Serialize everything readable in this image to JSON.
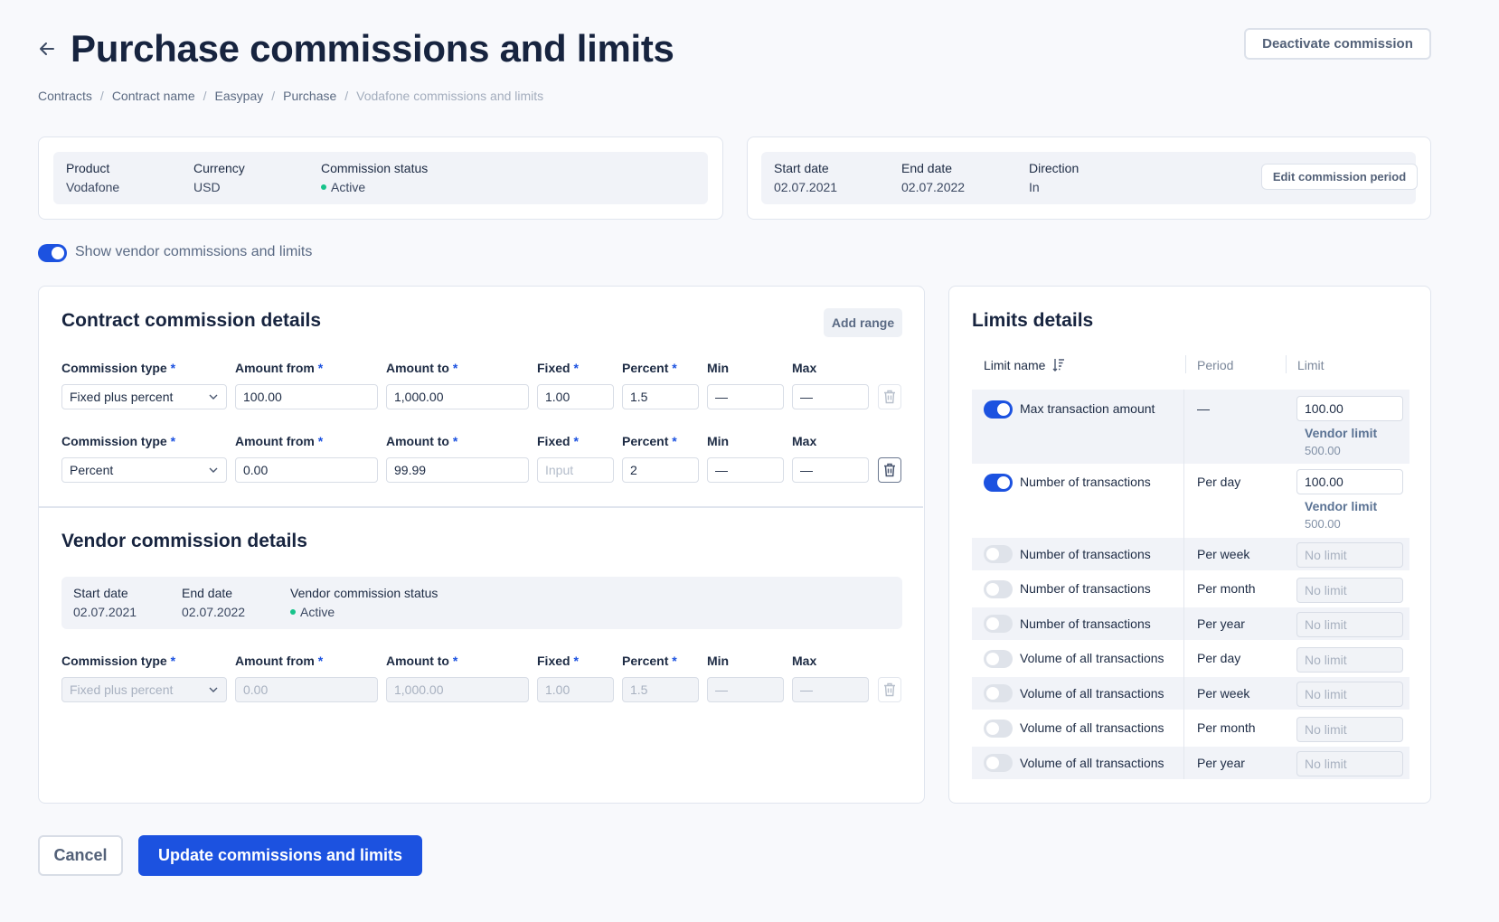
{
  "header": {
    "title": "Purchase commissions and limits",
    "deactivate_label": "Deactivate commission"
  },
  "breadcrumbs": [
    "Contracts",
    "Contract name",
    "Easypay",
    "Purchase",
    "Vodafone commissions and limits"
  ],
  "summary": {
    "product_label": "Product",
    "product": "Vodafone",
    "currency_label": "Currency",
    "currency": "USD",
    "status_label": "Commission status",
    "status": "Active",
    "start_label": "Start date",
    "start": "02.07.2021",
    "end_label": "End date",
    "end": "02.07.2022",
    "direction_label": "Direction",
    "direction": "In",
    "edit_period_label": "Edit commission period"
  },
  "show_vendor": {
    "label": "Show vendor commissions and limits",
    "on": true
  },
  "contract": {
    "title": "Contract commission details",
    "add_range": "Add range",
    "labels": {
      "type": "Commission type",
      "from": "Amount from",
      "to": "Amount to",
      "fixed": "Fixed",
      "percent": "Percent",
      "min": "Min",
      "max": "Max",
      "req": "*"
    },
    "rows": [
      {
        "type": "Fixed plus percent",
        "from": "100.00",
        "to": "1,000.00",
        "fixed": "1.00",
        "percent": "1.5",
        "min": "—",
        "max": "—"
      },
      {
        "type": "Percent",
        "from": "0.00",
        "to": "99.99",
        "fixed": "Input",
        "percent": "2",
        "min": "—",
        "max": "—"
      }
    ]
  },
  "vendor": {
    "title": "Vendor commission details",
    "start_label": "Start date",
    "start": "02.07.2021",
    "end_label": "End date",
    "end": "02.07.2022",
    "status_label": "Vendor commission status",
    "status": "Active",
    "row": {
      "type": "Fixed plus percent",
      "from": "0.00",
      "to": "1,000.00",
      "fixed": "1.00",
      "percent": "1.5",
      "min": "—",
      "max": "—"
    }
  },
  "limits": {
    "title": "Limits details",
    "headers": {
      "name": "Limit name",
      "period": "Period",
      "limit": "Limit"
    },
    "vendor_limit_label": "Vendor limit",
    "rows": [
      {
        "name": "Max transaction amount",
        "period": "—",
        "value": "100.00",
        "on": true,
        "vendor_limit": "500.00"
      },
      {
        "name": "Number of transactions",
        "period": "Per day",
        "value": "100.00",
        "on": true,
        "vendor_limit": "500.00"
      },
      {
        "name": "Number of transactions",
        "period": "Per week",
        "placeholder": "No limit",
        "on": false
      },
      {
        "name": "Number of transactions",
        "period": "Per month",
        "placeholder": "No limit",
        "on": false
      },
      {
        "name": "Number of transactions",
        "period": "Per year",
        "placeholder": "No limit",
        "on": false
      },
      {
        "name": "Volume of all transactions",
        "period": "Per day",
        "placeholder": "No limit",
        "on": false
      },
      {
        "name": "Volume of all transactions",
        "period": "Per week",
        "placeholder": "No limit",
        "on": false
      },
      {
        "name": "Volume of all transactions",
        "period": "Per month",
        "placeholder": "No limit",
        "on": false
      },
      {
        "name": "Volume of all transactions",
        "period": "Per year",
        "placeholder": "No limit",
        "on": false
      }
    ]
  },
  "footer": {
    "cancel": "Cancel",
    "update": "Update commissions and limits"
  }
}
